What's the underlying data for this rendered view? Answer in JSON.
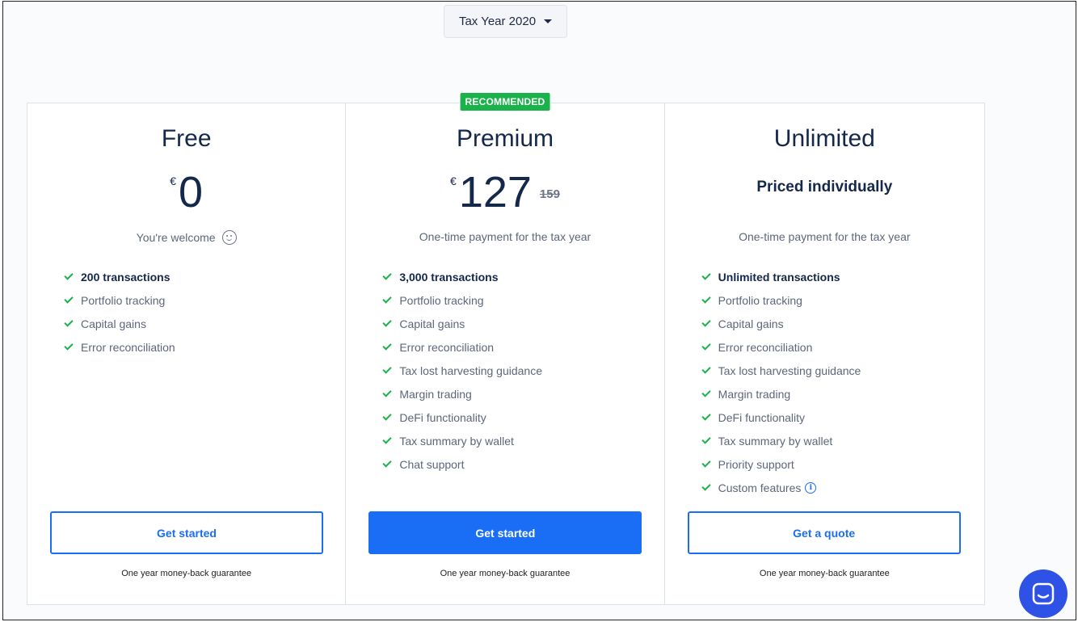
{
  "header": {
    "tax_year_label": "Tax Year 2020"
  },
  "plans": [
    {
      "name": "Free",
      "currency": "€",
      "price": "0",
      "subtitle": "You're welcome",
      "features": [
        "200 transactions",
        "Portfolio tracking",
        "Capital gains",
        "Error reconciliation"
      ],
      "cta": "Get started",
      "guarantee": "One year money-back guarantee"
    },
    {
      "name": "Premium",
      "badge": "RECOMMENDED",
      "currency": "€",
      "price": "127",
      "old_price": "159",
      "subtitle": "One-time payment for the tax year",
      "features": [
        "3,000 transactions",
        "Portfolio tracking",
        "Capital gains",
        "Error reconciliation",
        "Tax lost harvesting guidance",
        "Margin trading",
        "DeFi functionality",
        "Tax summary by wallet",
        "Chat support"
      ],
      "cta": "Get started",
      "guarantee": "One year money-back guarantee"
    },
    {
      "name": "Unlimited",
      "price_text": "Priced individually",
      "subtitle": "One-time payment for the tax year",
      "features": [
        "Unlimited transactions",
        "Portfolio tracking",
        "Capital gains",
        "Error reconciliation",
        "Tax lost harvesting guidance",
        "Margin trading",
        "DeFi functionality",
        "Tax summary by wallet",
        "Priority support",
        "Custom features"
      ],
      "cta": "Get a quote",
      "guarantee": "One year money-back guarantee"
    }
  ],
  "colors": {
    "accent": "#1a6ef5",
    "check": "#1bb24b",
    "badge": "#1bb24b",
    "chat": "#2f52e6"
  }
}
